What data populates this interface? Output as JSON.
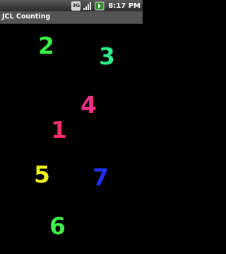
{
  "status_bar": {
    "network_badge_top": "3G",
    "network_badge_bottom": "",
    "time": "8:17",
    "time_suffix": "PM"
  },
  "app": {
    "title": "JCL Counting"
  },
  "numbers": [
    {
      "value": "2",
      "color": "#3ef04a"
    },
    {
      "value": "3",
      "color": "#2ef08a"
    },
    {
      "value": "4",
      "color": "#ff2d8a"
    },
    {
      "value": "1",
      "color": "#ff2d6a"
    },
    {
      "value": "5",
      "color": "#f5f51e"
    },
    {
      "value": "7",
      "color": "#1e30ff"
    },
    {
      "value": "6",
      "color": "#3ef04a"
    }
  ],
  "colors": {
    "background": "#000000",
    "status_bar": "#3a3a3a",
    "title_bar": "#545454"
  },
  "icons": [
    "network-3g-icon",
    "signal-strength-icon",
    "battery-icon"
  ]
}
